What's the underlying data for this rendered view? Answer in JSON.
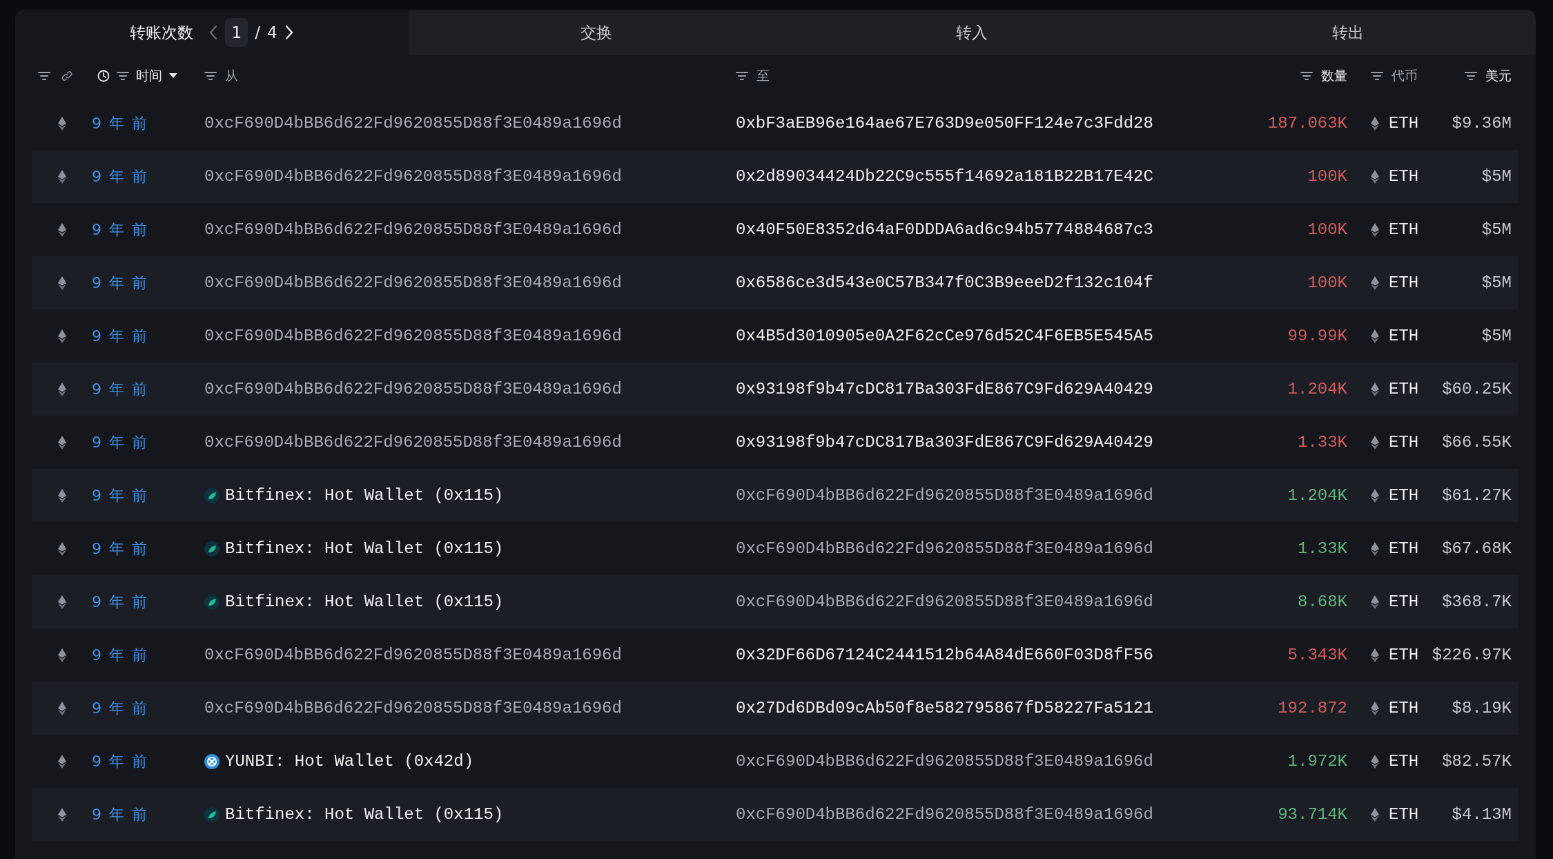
{
  "tabs": [
    {
      "label": "转账次数",
      "selected": true,
      "pager": {
        "current": "1",
        "separator": "/",
        "total": "4"
      }
    },
    {
      "label": "交换",
      "selected": false
    },
    {
      "label": "转入",
      "selected": false
    },
    {
      "label": "转出",
      "selected": false
    }
  ],
  "columns": [
    {
      "kind": "links"
    },
    {
      "kind": "time",
      "label": "时间",
      "sorted": true
    },
    {
      "kind": "from",
      "label": "从"
    },
    {
      "kind": "to",
      "label": "至"
    },
    {
      "kind": "amount",
      "label": "数量"
    },
    {
      "kind": "token",
      "label": "代币"
    },
    {
      "kind": "usd",
      "label": "美元"
    }
  ],
  "rows": [
    {
      "time": "9 年 前",
      "from": {
        "kind": "own",
        "text": "0xcF690D4bBB6d622Fd9620855D88f3E0489a1696d"
      },
      "to": {
        "kind": "address",
        "text": "0xbF3aEB96e164ae67E763D9e050FF124e7c3Fdd28"
      },
      "amount": "187.063K",
      "color": "#d65a5c",
      "token": "ETH",
      "usd": "$9.36M"
    },
    {
      "time": "9 年 前",
      "from": {
        "kind": "own",
        "text": "0xcF690D4bBB6d622Fd9620855D88f3E0489a1696d"
      },
      "to": {
        "kind": "address",
        "text": "0x2d89034424Db22C9c555f14692a181B22B17E42C"
      },
      "amount": "100K",
      "color": "#d65a5c",
      "token": "ETH",
      "usd": "$5M"
    },
    {
      "time": "9 年 前",
      "from": {
        "kind": "own",
        "text": "0xcF690D4bBB6d622Fd9620855D88f3E0489a1696d"
      },
      "to": {
        "kind": "address",
        "text": "0x40F50E8352d64aF0DDDA6ad6c94b5774884687c3"
      },
      "amount": "100K",
      "color": "#d65a5c",
      "token": "ETH",
      "usd": "$5M"
    },
    {
      "time": "9 年 前",
      "from": {
        "kind": "own",
        "text": "0xcF690D4bBB6d622Fd9620855D88f3E0489a1696d"
      },
      "to": {
        "kind": "address",
        "text": "0x6586ce3d543e0C57B347f0C3B9eeeD2f132c104f"
      },
      "amount": "100K",
      "color": "#d65a5c",
      "token": "ETH",
      "usd": "$5M"
    },
    {
      "time": "9 年 前",
      "from": {
        "kind": "own",
        "text": "0xcF690D4bBB6d622Fd9620855D88f3E0489a1696d"
      },
      "to": {
        "kind": "address",
        "text": "0x4B5d3010905e0A2F62cCe976d52C4F6EB5E545A5"
      },
      "amount": "99.99K",
      "color": "#d65a5c",
      "token": "ETH",
      "usd": "$5M"
    },
    {
      "time": "9 年 前",
      "from": {
        "kind": "own",
        "text": "0xcF690D4bBB6d622Fd9620855D88f3E0489a1696d"
      },
      "to": {
        "kind": "address",
        "text": "0x93198f9b47cDC817Ba303FdE867C9Fd629A40429"
      },
      "amount": "1.204K",
      "color": "#d65a5c",
      "token": "ETH",
      "usd": "$60.25K"
    },
    {
      "time": "9 年 前",
      "from": {
        "kind": "own",
        "text": "0xcF690D4bBB6d622Fd9620855D88f3E0489a1696d"
      },
      "to": {
        "kind": "address",
        "text": "0x93198f9b47cDC817Ba303FdE867C9Fd629A40429"
      },
      "amount": "1.33K",
      "color": "#d65a5c",
      "token": "ETH",
      "usd": "$66.55K"
    },
    {
      "time": "9 年 前",
      "from": {
        "kind": "leaf",
        "text": "Bitfinex: Hot Wallet (0x115)"
      },
      "to": {
        "kind": "own",
        "text": "0xcF690D4bBB6d622Fd9620855D88f3E0489a1696d"
      },
      "amount": "1.204K",
      "color": "#5cb67a",
      "token": "ETH",
      "usd": "$61.27K"
    },
    {
      "time": "9 年 前",
      "from": {
        "kind": "leaf",
        "text": "Bitfinex: Hot Wallet (0x115)"
      },
      "to": {
        "kind": "own",
        "text": "0xcF690D4bBB6d622Fd9620855D88f3E0489a1696d"
      },
      "amount": "1.33K",
      "color": "#5cb67a",
      "token": "ETH",
      "usd": "$67.68K"
    },
    {
      "time": "9 年 前",
      "from": {
        "kind": "leaf",
        "text": "Bitfinex: Hot Wallet (0x115)"
      },
      "to": {
        "kind": "own",
        "text": "0xcF690D4bBB6d622Fd9620855D88f3E0489a1696d"
      },
      "amount": "8.68K",
      "color": "#5cb67a",
      "token": "ETH",
      "usd": "$368.7K"
    },
    {
      "time": "9 年 前",
      "from": {
        "kind": "own",
        "text": "0xcF690D4bBB6d622Fd9620855D88f3E0489a1696d"
      },
      "to": {
        "kind": "address",
        "text": "0x32DF66D67124C2441512b64A84dE660F03D8fF56"
      },
      "amount": "5.343K",
      "color": "#d65a5c",
      "token": "ETH",
      "usd": "$226.97K"
    },
    {
      "time": "9 年 前",
      "from": {
        "kind": "own",
        "text": "0xcF690D4bBB6d622Fd9620855D88f3E0489a1696d"
      },
      "to": {
        "kind": "address",
        "text": "0x27Dd6DBd09cAb50f8e582795867fD58227Fa5121"
      },
      "amount": "192.872",
      "color": "#d65a5c",
      "token": "ETH",
      "usd": "$8.19K"
    },
    {
      "time": "9 年 前",
      "from": {
        "kind": "swirl",
        "text": "YUNBI: Hot Wallet (0x42d)"
      },
      "to": {
        "kind": "own",
        "text": "0xcF690D4bBB6d622Fd9620855D88f3E0489a1696d"
      },
      "amount": "1.972K",
      "color": "#5cb67a",
      "token": "ETH",
      "usd": "$82.57K"
    },
    {
      "time": "9 年 前",
      "from": {
        "kind": "leaf",
        "text": "Bitfinex: Hot Wallet (0x115)"
      },
      "to": {
        "kind": "own",
        "text": "0xcF690D4bBB6d622Fd9620855D88f3E0489a1696d"
      },
      "amount": "93.714K",
      "color": "#5cb67a",
      "token": "ETH",
      "usd": "$4.13M"
    }
  ]
}
